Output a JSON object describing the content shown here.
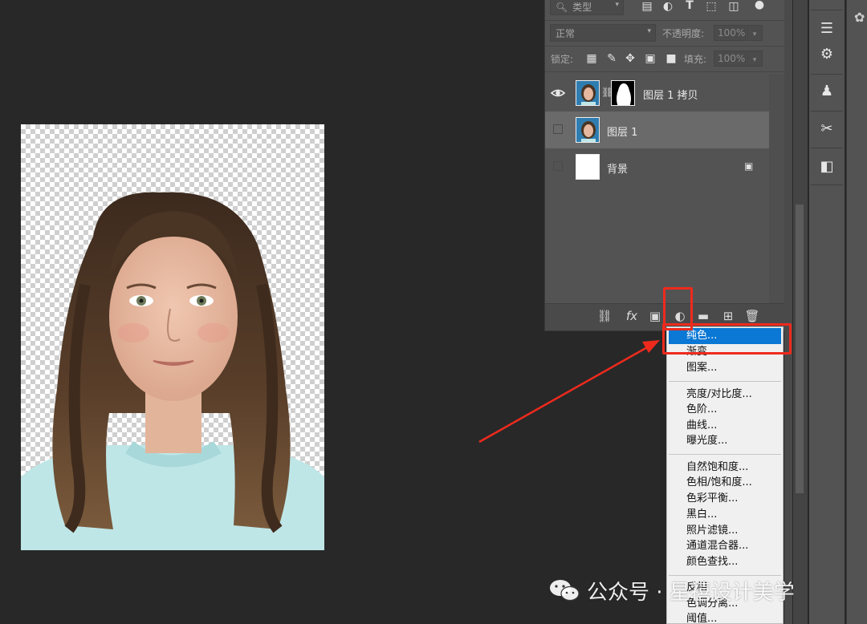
{
  "layers_panel": {
    "filter_kind": "类型",
    "blend_mode": "正常",
    "opacity_label": "不透明度:",
    "opacity_value": "100%",
    "lock_label": "锁定:",
    "fill_label": "填充:",
    "fill_value": "100%",
    "layers": [
      {
        "name": "图层 1 拷贝",
        "visible": true,
        "selected": false,
        "has_mask": true
      },
      {
        "name": "图层 1",
        "visible": false,
        "selected": true,
        "has_mask": false
      },
      {
        "name": "背景",
        "visible": false,
        "selected": false,
        "locked": true
      }
    ]
  },
  "adjustment_menu": {
    "groups": [
      [
        "纯色...",
        "渐变...",
        "图案..."
      ],
      [
        "亮度/对比度...",
        "色阶...",
        "曲线...",
        "曝光度..."
      ],
      [
        "自然饱和度...",
        "色相/饱和度...",
        "色彩平衡...",
        "黑白...",
        "照片滤镜...",
        "通道混合器...",
        "颜色查找..."
      ],
      [
        "反相",
        "色调分离...",
        "阈值..."
      ]
    ],
    "highlighted": "纯色..."
  },
  "watermark": {
    "text": "公众号 · 星禧设计美学"
  },
  "colors": {
    "accent": "#0a78d4",
    "annotation": "#ee2a1d",
    "panel": "#535353"
  }
}
